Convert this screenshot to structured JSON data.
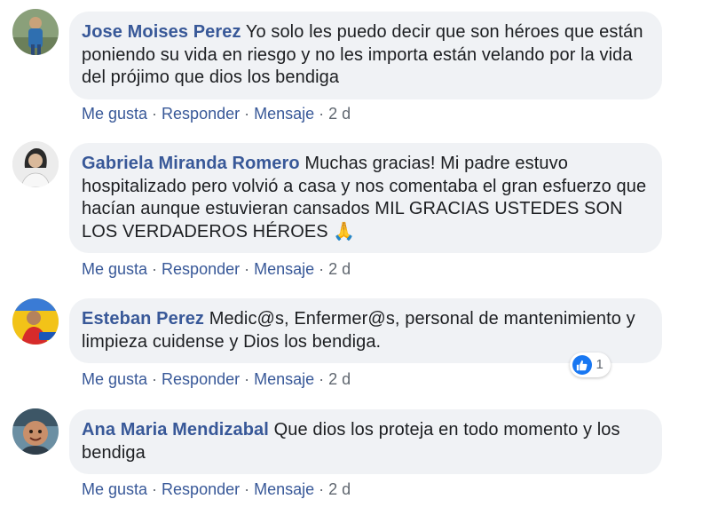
{
  "comments": [
    {
      "author": "Jose Moises Perez",
      "text": "Yo solo les puedo decir que son héroes que están poniendo su vida en riesgo y no les importa están velando por la vida del prójimo que dios los bendiga",
      "actions": {
        "like": "Me gusta",
        "reply": "Responder",
        "message": "Mensaje",
        "time": "2 d"
      }
    },
    {
      "author": "Gabriela Miranda Romero",
      "text": "Muchas gracias! Mi padre estuvo hospitalizado pero volvió a casa y nos comentaba el gran esfuerzo que hacían aunque estuvieran cansados MIL GRACIAS USTEDES SON LOS VERDADEROS HÉROES 🙏",
      "actions": {
        "like": "Me gusta",
        "reply": "Responder",
        "message": "Mensaje",
        "time": "2 d"
      }
    },
    {
      "author": "Esteban Perez",
      "text": "Medic@s, Enfermer@s, personal de mantenimiento y limpieza cuidense y Dios los bendiga.",
      "reaction_count": "1",
      "actions": {
        "like": "Me gusta",
        "reply": "Responder",
        "message": "Mensaje",
        "time": "2 d"
      }
    },
    {
      "author": "Ana Maria Mendizabal",
      "text": "Que dios los proteja en todo momento y los bendiga",
      "actions": {
        "like": "Me gusta",
        "reply": "Responder",
        "message": "Mensaje",
        "time": "2 d"
      }
    }
  ],
  "icons": {
    "reaction": "like-icon"
  },
  "colors": {
    "author": "#385898",
    "bubble": "#f0f2f5",
    "like_blue": "#1877f2",
    "meta": "#606770"
  }
}
